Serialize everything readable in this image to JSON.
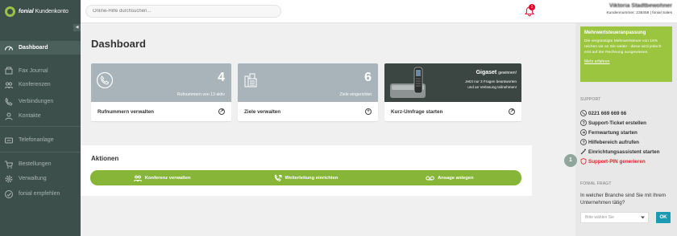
{
  "app": {
    "brand": "fonial",
    "brand_sub": "Kundenkonto"
  },
  "search": {
    "placeholder": "Online-Hilfe durchsuchen..."
  },
  "notifications": {
    "count": "1"
  },
  "user": {
    "name": "Viktoria Stadtbewohner",
    "customer_number": "Kundennummer: 235458 | fonial Sales"
  },
  "sidebar": {
    "collapse_icon": "◀",
    "items": [
      {
        "label": "Dashboard",
        "icon": "gauge-icon"
      },
      {
        "label": "Fax Journal",
        "icon": "fax-icon"
      },
      {
        "label": "Konferenzen",
        "icon": "conference-icon"
      },
      {
        "label": "Verbindungen",
        "icon": "phone-icon"
      },
      {
        "label": "Kontakte",
        "icon": "contacts-icon"
      },
      {
        "label": "Telefonanlage",
        "icon": "pbx-icon"
      },
      {
        "label": "Bestellungen",
        "icon": "cart-icon"
      },
      {
        "label": "Verwaltung",
        "icon": "gear-icon"
      },
      {
        "label": "fonial empfehlen",
        "icon": "recommend-icon"
      }
    ]
  },
  "main": {
    "title": "Dashboard",
    "cards": [
      {
        "number": "4",
        "sub": "Rufnummern von 13 aktiv",
        "label": "Rufnummern verwalten",
        "action": "↗"
      },
      {
        "number": "6",
        "sub": "Ziele eingerichtet",
        "label": "Ziele verwalten",
        "action": "+"
      },
      {
        "brand": "Gigaset",
        "brand_suffix": "gewinnen!",
        "text1": "Jetzt nur 3 Fragen beantworten",
        "text2": "und an Verlosung teilnehmen!",
        "label": "Kurz-Umfrage starten",
        "action": "↗"
      }
    ],
    "aktionen": {
      "title": "Aktionen",
      "buttons": [
        {
          "label": "Konferenz verwalten"
        },
        {
          "label": "Weiterleitung einrichten"
        },
        {
          "label": "Ansage anlegen"
        }
      ]
    }
  },
  "right": {
    "mwst": {
      "title": "Mehrwertsteueranpassung",
      "text": "Die vergünstigte Mehrwertsteuer von 16% reichen wir an Sie weiter - diese wird jedoch erst auf der Rechnung ausgewiesen.",
      "link": "Mehr erfahren"
    },
    "support_label": "SUPPORT",
    "support": [
      "0221 669 669 66",
      "Support-Ticket erstellen",
      "Fernwartung starten",
      "Hilfebereich aufrufen",
      "Einrichtungsassistent starten",
      "Support-PIN generieren"
    ],
    "step_badge": "1",
    "frage_label": "FONIAL FRAGT",
    "frage_text": "In welcher Branche sind Sie mit Ihrem Unternehmen tätig?",
    "select_value": "Bitte wählen Sie",
    "ok_label": "OK"
  },
  "colors": {
    "sidebar": "#3c4f4b",
    "accent_green": "#86b537",
    "mwst_green": "#9bc43f",
    "alert_red": "#e0212a",
    "ok_blue": "#1b9bb3"
  }
}
